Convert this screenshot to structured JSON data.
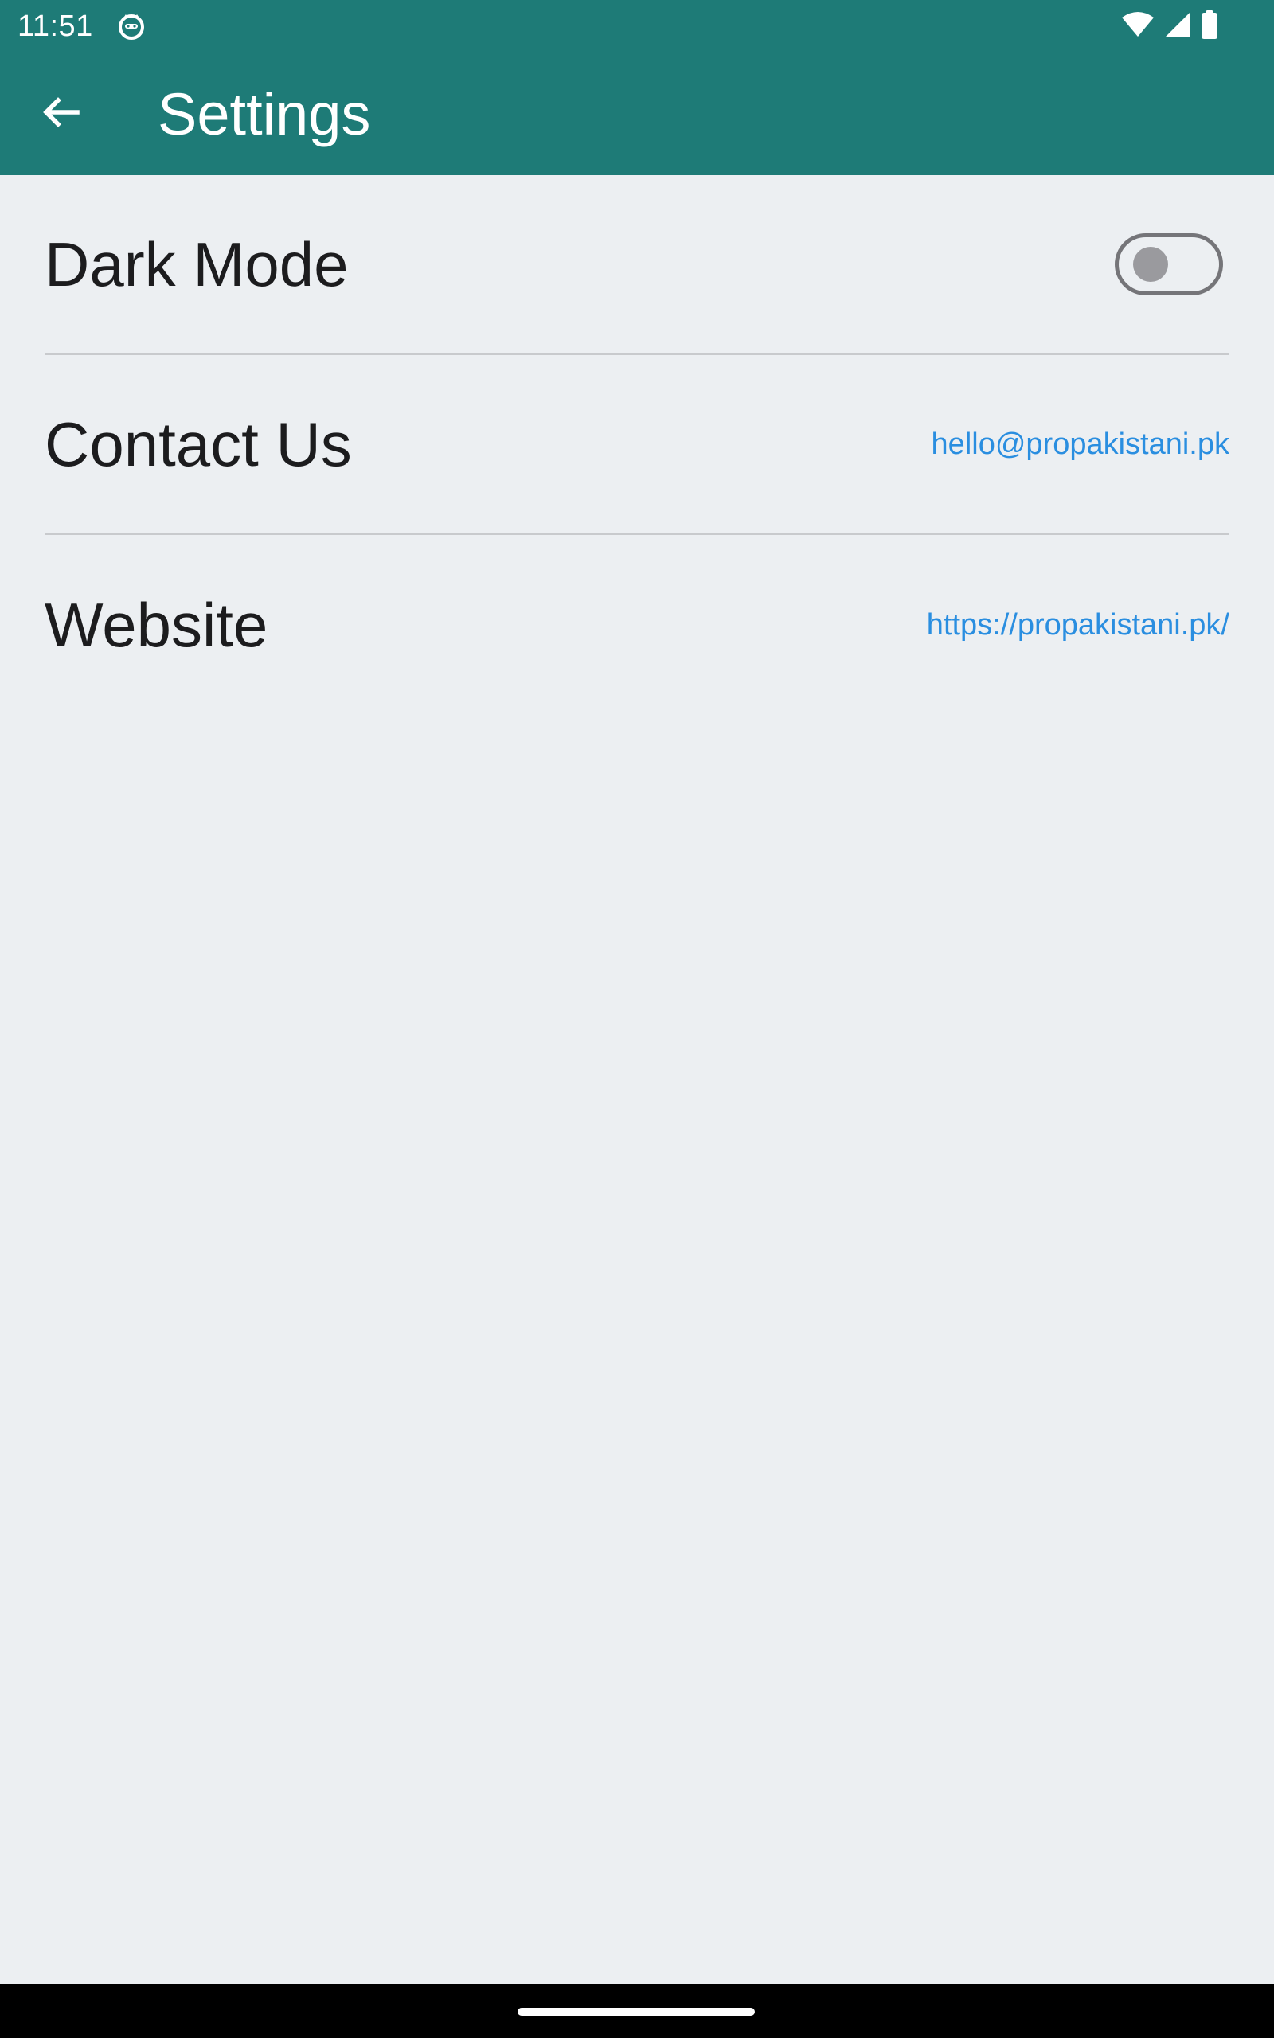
{
  "status_bar": {
    "time": "11:51",
    "app_icon": "cat-icon",
    "icons": [
      "wifi-icon",
      "signal-icon",
      "battery-icon"
    ]
  },
  "app_bar": {
    "back_icon": "arrow-left-icon",
    "title": "Settings"
  },
  "settings": {
    "dark_mode": {
      "label": "Dark Mode",
      "enabled": false
    },
    "contact": {
      "label": "Contact Us",
      "value": "hello@propakistani.pk"
    },
    "website": {
      "label": "Website",
      "value": "https://propakistani.pk/"
    }
  },
  "colors": {
    "primary": "#1e7b77",
    "background": "#eceff2",
    "link": "#2a8ee0",
    "divider": "#c8cacd"
  }
}
